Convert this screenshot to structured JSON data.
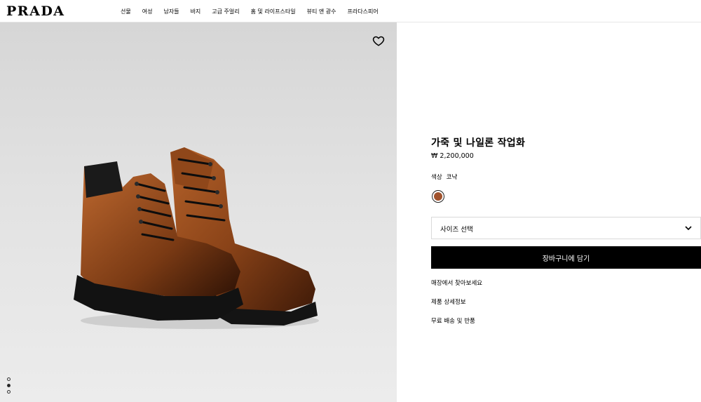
{
  "header": {
    "logo": "PRADA",
    "nav": [
      "선물",
      "여성",
      "남자들",
      "바지",
      "고급 주얼리",
      "홈 및 라이프스타일",
      "뷰티 앤 광수",
      "프라다스피어"
    ]
  },
  "gallery": {
    "wishlist_icon": "heart-icon",
    "image_alt": "leather and nylon work boots",
    "dot_count": 3,
    "active_dot": 1
  },
  "product": {
    "title": "가죽 및 나일론 작업화",
    "price": "₩ 2,200,000",
    "color_label": "색상",
    "color_value": "코냑",
    "swatch_color": "#a0522d",
    "size_placeholder": "사이즈 선택",
    "add_to_cart": "장바구니에 담기",
    "links": [
      "매장에서 찾아보세요",
      "제품 상세정보",
      "무료 배송 및 반품"
    ]
  }
}
